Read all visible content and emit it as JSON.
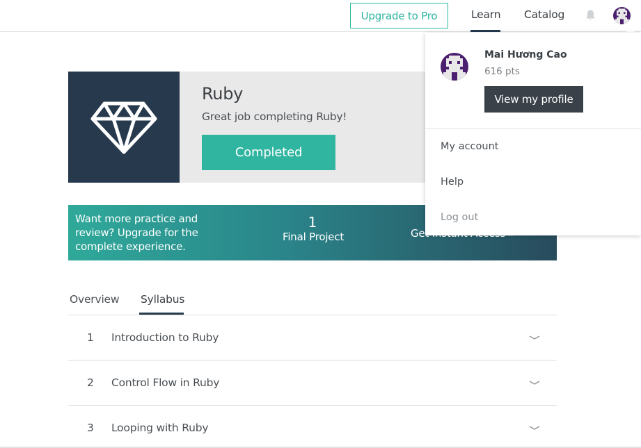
{
  "nav": {
    "upgrade_label": "Upgrade to Pro",
    "learn_label": "Learn",
    "catalog_label": "Catalog",
    "icons": [
      "bell-icon",
      "avatar"
    ]
  },
  "course": {
    "title": "Ruby",
    "subtitle": "Great job completing Ruby!",
    "status_button": "Completed",
    "icon": "diamond-icon"
  },
  "promo": {
    "text": "Want more practice and review? Upgrade for the complete experience.",
    "stat_value": "1",
    "stat_label": "Final Project",
    "cta_label": "Get Instant Access »"
  },
  "tabs": [
    {
      "label": "Overview",
      "active": false
    },
    {
      "label": "Syllabus",
      "active": true
    }
  ],
  "syllabus": [
    {
      "num": "1",
      "title": "Introduction to Ruby"
    },
    {
      "num": "2",
      "title": "Control Flow in Ruby"
    },
    {
      "num": "3",
      "title": "Looping with Ruby"
    }
  ],
  "user_menu": {
    "name": "Mai Hương Cao",
    "points": "616 pts",
    "profile_button": "View my profile",
    "items": [
      "My account",
      "Help",
      "Log out"
    ]
  },
  "colors": {
    "accent": "#2fb5a0",
    "navy": "#26394d",
    "avatar_bg": "#4b1f6f"
  }
}
